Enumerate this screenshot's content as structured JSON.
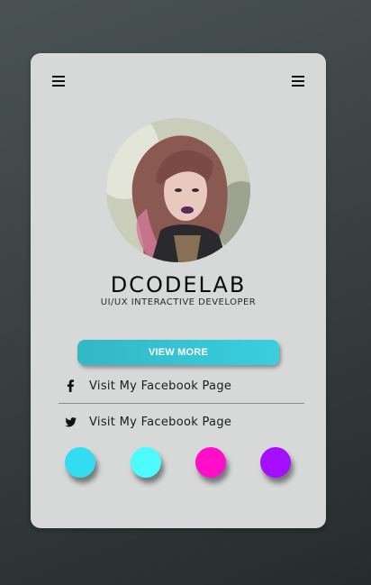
{
  "profile": {
    "name": "DCODELAB",
    "role": "UI/UX INTERACTIVE DEVELOPER"
  },
  "menu": {
    "left_icon": "hamburger-menu-icon",
    "right_icon": "hamburger-menu-icon"
  },
  "actions": {
    "view_more_label": "VIEW MORE"
  },
  "links": [
    {
      "icon": "facebook-icon",
      "label": "Visit My Facebook Page"
    },
    {
      "icon": "twitter-icon",
      "label": "Visit My Facebook Page"
    }
  ],
  "colors": {
    "button_start": "#33b7c4",
    "button_end": "#38cfe0",
    "swatches": [
      "#33dcf0",
      "#4dfaff",
      "#ff10c8",
      "#a410ff"
    ]
  }
}
